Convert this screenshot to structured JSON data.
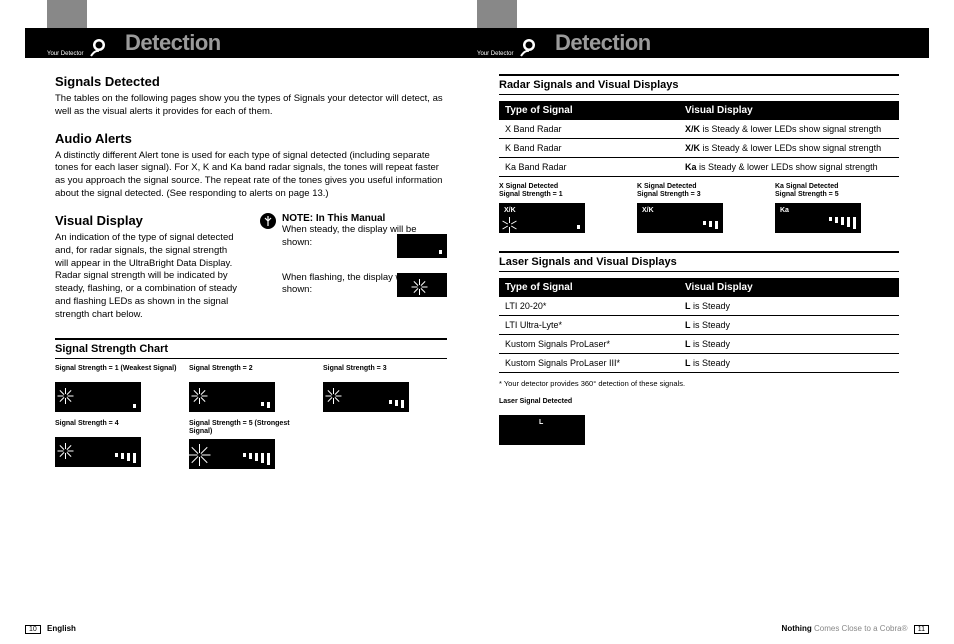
{
  "header": {
    "brand_small": "Your Detector",
    "section": "Detection"
  },
  "left": {
    "h1": "Signals Detected",
    "p1": "The tables on the following pages show you the types of Signals your detector will detect, as well as the visual alerts it provides for each of them.",
    "h2": "Audio Alerts",
    "p2": "A distinctly different Alert tone is used for each type of signal detected (including separate tones for each laser signal). For X, K and Ka band radar signals, the tones will repeat faster as you approach the signal source. The repeat rate of the tones gives you useful information about the signal detected. (See responding to alerts on page 13.)",
    "h3": "Visual Display",
    "p3": "An indication of the type of signal detected and, for radar signals, the signal strength will appear in the UltraBright Data Display. Radar signal strength will be indicated by steady, flashing, or a combination of steady and flashing LEDs as shown in the signal strength chart below.",
    "note_label": "NOTE: In This Manual",
    "note_steady": "When steady, the display will be shown:",
    "note_flashing": "When flashing, the display will be shown:",
    "chart_title": "Signal Strength Chart",
    "chart": [
      {
        "label": "Signal Strength = 1 (Weakest Signal)"
      },
      {
        "label": "Signal Strength = 2"
      },
      {
        "label": "Signal Strength = 3"
      },
      {
        "label": "Signal Strength = 4"
      },
      {
        "label": "Signal Strength = 5 (Strongest Signal)"
      },
      {
        "label": ""
      }
    ]
  },
  "right": {
    "radar_title": "Radar Signals and Visual Displays",
    "col_signal": "Type of Signal",
    "col_display": "Visual Display",
    "radar_rows": [
      {
        "signal": "X Band Radar",
        "display_strong": "X/K",
        "display_rest": " is Steady & lower LEDs show signal strength"
      },
      {
        "signal": "K Band Radar",
        "display_strong": "X/K",
        "display_rest": " is Steady & lower LEDs show signal strength"
      },
      {
        "signal": "Ka Band Radar",
        "display_strong": "Ka",
        "display_rest": " is Steady & lower LEDs show signal strength"
      }
    ],
    "radar_examples": [
      {
        "line1": "X Signal Detected",
        "line2": "Signal Strength = 1",
        "band": "X/K"
      },
      {
        "line1": "K Signal Detected",
        "line2": "Signal Strength = 3",
        "band": "X/K"
      },
      {
        "line1": "Ka Signal Detected",
        "line2": "Signal Strength = 5",
        "band": "Ka"
      }
    ],
    "laser_title": "Laser Signals and Visual Displays",
    "laser_rows": [
      {
        "signal": "LTI 20-20*",
        "display_strong": "L",
        "display_rest": " is Steady"
      },
      {
        "signal": "LTI Ultra-Lyte*",
        "display_strong": "L",
        "display_rest": " is Steady"
      },
      {
        "signal": "Kustom Signals ProLaser*",
        "display_strong": "L",
        "display_rest": " is Steady"
      },
      {
        "signal": "Kustom Signals ProLaser III*",
        "display_strong": "L",
        "display_rest": " is Steady"
      }
    ],
    "laser_footnote": "* Your detector provides 360° detection of these signals.",
    "laser_example_label": "Laser Signal Detected",
    "laser_band": "L"
  },
  "footer": {
    "left_page": "10",
    "left_lang": "English",
    "right_text_gray": "Nothing ",
    "right_text": "Comes Close to a Cobra®",
    "right_page": "11"
  }
}
